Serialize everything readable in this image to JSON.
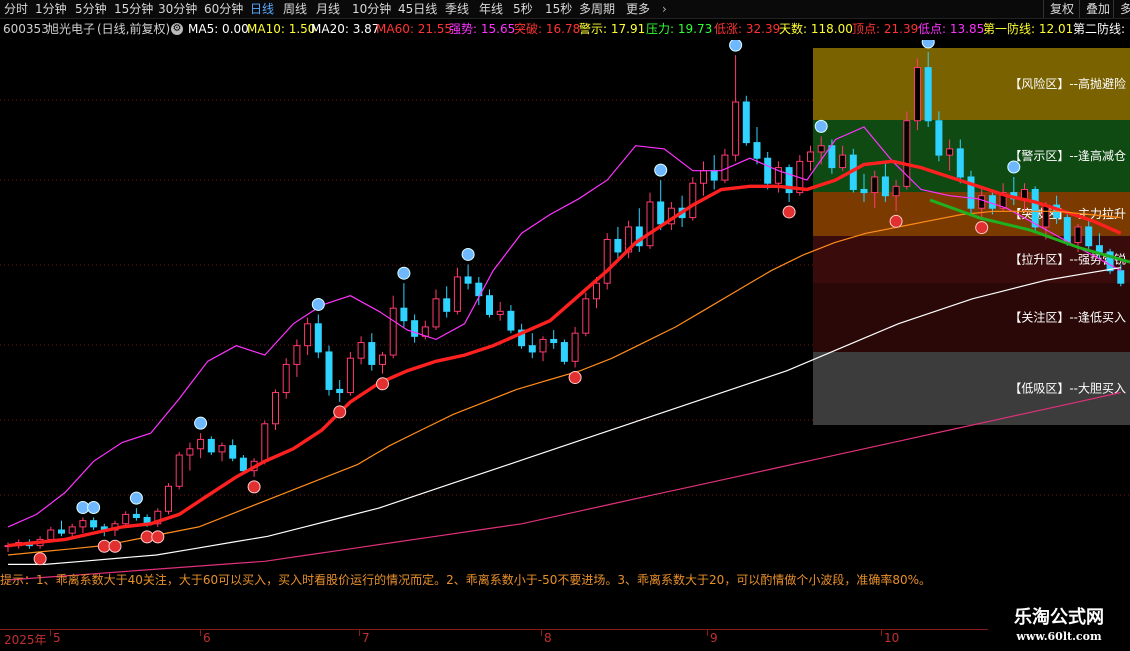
{
  "toolbar": {
    "tabs": [
      "分时",
      "1分钟",
      "5分钟",
      "15分钟",
      "30分钟",
      "60分钟",
      "日线",
      "周线",
      "月线",
      "10分钟",
      "45日线",
      "季线",
      "年线",
      "5秒",
      "15秒",
      "多周期",
      "更多"
    ],
    "active_tab": "日线",
    "more_arrow": "›",
    "right_buttons": [
      "复权",
      "叠加",
      "多"
    ]
  },
  "stock": {
    "code": "600353",
    "name": "旭光电子",
    "period": "(日线,前复权)"
  },
  "indicators": [
    {
      "label": "MA5: 0.00",
      "color": "#ffffff"
    },
    {
      "label": "MA10: 1.50",
      "color": "#ffff33"
    },
    {
      "label": "MA20: 3.87",
      "color": "#ffffff"
    },
    {
      "label": "MA60: 21.55",
      "color": "#ff3333"
    },
    {
      "label": "强势: 15.65",
      "color": "#ff33ff"
    },
    {
      "label": "突破: 16.78",
      "color": "#ff3333"
    },
    {
      "label": "警示: 17.91",
      "color": "#ffff33"
    },
    {
      "label": "压力: 19.73",
      "color": "#33ff33"
    },
    {
      "label": "低涨: 32.39",
      "color": "#ff3333"
    },
    {
      "label": "天数: 118.00",
      "color": "#ffff33"
    },
    {
      "label": "顶点: 21.39",
      "color": "#ff3333"
    },
    {
      "label": "低点: 13.85",
      "color": "#ff33ff"
    },
    {
      "label": "第一防线: 12.01",
      "color": "#ffff33"
    },
    {
      "label": "第二防线:",
      "color": "#ffffff"
    }
  ],
  "zones": [
    {
      "label": "【风险区】--高抛避险",
      "color": "#7a6200"
    },
    {
      "label": "【警示区】--逢高减仓",
      "color": "#0e4a12"
    },
    {
      "label": "【突破区】--主力拉升",
      "color": "#7a3a00"
    },
    {
      "label": "【拉升区】--强势营锐",
      "color": "#3a0b0b"
    },
    {
      "label": "【关注区】--逢低买入",
      "color": "#2a0808"
    },
    {
      "label": "【低吸区】--大胆买入",
      "color": "#3c3c3c"
    }
  ],
  "hint": "提示：1、乖离系数大于40关注，大于60可以买入，买入时看股价运行的情况而定。2、乖离系数小于-50不要进场。3、乖离系数大于20，可以酌情做个小波段，准确率80%。",
  "datebar": {
    "year": "2025年",
    "months": [
      "5",
      "6",
      "7",
      "8",
      "9",
      "10"
    ]
  },
  "watermark": {
    "title": "乐淘公式网",
    "url": "www.60lt.com"
  },
  "chart_data": {
    "type": "candlestick",
    "price_range": [
      4.5,
      21.4
    ],
    "ohlc": [
      [
        5.6,
        5.7,
        5.4,
        5.6
      ],
      [
        5.6,
        5.8,
        5.5,
        5.7
      ],
      [
        5.7,
        5.8,
        5.5,
        5.6
      ],
      [
        5.6,
        5.9,
        5.5,
        5.8
      ],
      [
        5.8,
        6.2,
        5.7,
        6.1
      ],
      [
        6.1,
        6.4,
        5.9,
        6.0
      ],
      [
        6.0,
        6.3,
        5.8,
        6.2
      ],
      [
        6.2,
        6.5,
        6.0,
        6.4
      ],
      [
        6.4,
        6.5,
        6.1,
        6.2
      ],
      [
        6.2,
        6.3,
        5.9,
        6.1
      ],
      [
        6.1,
        6.4,
        5.9,
        6.3
      ],
      [
        6.3,
        6.7,
        6.2,
        6.6
      ],
      [
        6.6,
        6.8,
        6.4,
        6.5
      ],
      [
        6.5,
        6.6,
        6.2,
        6.3
      ],
      [
        6.3,
        6.8,
        6.2,
        6.7
      ],
      [
        6.7,
        7.6,
        6.6,
        7.5
      ],
      [
        7.5,
        8.6,
        7.4,
        8.5
      ],
      [
        8.5,
        8.9,
        8.0,
        8.7
      ],
      [
        8.7,
        9.2,
        8.4,
        9.0
      ],
      [
        9.0,
        9.1,
        8.5,
        8.6
      ],
      [
        8.6,
        8.9,
        8.3,
        8.8
      ],
      [
        8.8,
        9.0,
        8.3,
        8.4
      ],
      [
        8.4,
        8.5,
        7.9,
        8.0
      ],
      [
        8.0,
        8.4,
        7.8,
        8.3
      ],
      [
        8.3,
        9.6,
        8.2,
        9.5
      ],
      [
        9.5,
        10.6,
        9.3,
        10.5
      ],
      [
        10.5,
        11.6,
        10.3,
        11.4
      ],
      [
        11.4,
        12.2,
        11.0,
        12.0
      ],
      [
        12.0,
        12.9,
        11.7,
        12.7
      ],
      [
        12.7,
        13.0,
        11.6,
        11.8
      ],
      [
        11.8,
        12.0,
        10.4,
        10.6
      ],
      [
        10.6,
        10.9,
        10.2,
        10.5
      ],
      [
        10.5,
        11.8,
        10.4,
        11.6
      ],
      [
        11.6,
        12.3,
        11.4,
        12.1
      ],
      [
        12.1,
        12.4,
        11.2,
        11.4
      ],
      [
        11.4,
        11.8,
        11.1,
        11.7
      ],
      [
        11.7,
        13.6,
        11.6,
        13.2
      ],
      [
        13.2,
        14.0,
        12.6,
        12.8
      ],
      [
        12.8,
        13.0,
        12.1,
        12.3
      ],
      [
        12.3,
        12.8,
        12.2,
        12.6
      ],
      [
        12.6,
        13.8,
        12.5,
        13.5
      ],
      [
        13.5,
        13.9,
        12.9,
        13.1
      ],
      [
        13.1,
        14.5,
        13.0,
        14.2
      ],
      [
        14.2,
        14.6,
        13.8,
        14.0
      ],
      [
        14.0,
        14.2,
        13.3,
        13.6
      ],
      [
        13.6,
        13.8,
        12.9,
        13.0
      ],
      [
        13.0,
        13.4,
        12.8,
        13.1
      ],
      [
        13.1,
        13.3,
        12.4,
        12.5
      ],
      [
        12.5,
        12.7,
        11.9,
        12.0
      ],
      [
        12.0,
        12.4,
        11.6,
        11.8
      ],
      [
        11.8,
        12.3,
        11.5,
        12.2
      ],
      [
        12.2,
        12.5,
        11.9,
        12.1
      ],
      [
        12.1,
        12.2,
        11.4,
        11.5
      ],
      [
        11.5,
        12.6,
        11.3,
        12.4
      ],
      [
        12.4,
        13.7,
        12.3,
        13.5
      ],
      [
        13.5,
        14.2,
        13.2,
        14.0
      ],
      [
        14.0,
        15.6,
        13.8,
        15.4
      ],
      [
        15.4,
        15.8,
        14.8,
        15.0
      ],
      [
        15.0,
        16.0,
        14.8,
        15.8
      ],
      [
        15.8,
        16.4,
        15.0,
        15.2
      ],
      [
        15.2,
        16.9,
        15.1,
        16.6
      ],
      [
        16.6,
        17.3,
        15.7,
        15.9
      ],
      [
        15.9,
        16.6,
        15.7,
        16.4
      ],
      [
        16.4,
        16.8,
        15.8,
        16.1
      ],
      [
        16.1,
        17.4,
        16.0,
        17.2
      ],
      [
        17.2,
        17.9,
        16.8,
        17.6
      ],
      [
        17.6,
        18.1,
        17.0,
        17.3
      ],
      [
        17.3,
        18.3,
        17.2,
        18.1
      ],
      [
        18.1,
        21.3,
        17.9,
        19.8
      ],
      [
        19.8,
        20.0,
        18.4,
        18.5
      ],
      [
        18.5,
        19.0,
        17.8,
        18.0
      ],
      [
        18.0,
        18.2,
        17.0,
        17.2
      ],
      [
        17.2,
        17.9,
        16.9,
        17.7
      ],
      [
        17.7,
        17.8,
        16.6,
        16.9
      ],
      [
        16.9,
        18.1,
        16.8,
        17.9
      ],
      [
        17.9,
        18.4,
        17.6,
        18.2
      ],
      [
        18.2,
        18.7,
        17.8,
        18.4
      ],
      [
        18.4,
        18.6,
        17.5,
        17.7
      ],
      [
        17.7,
        18.4,
        17.6,
        18.1
      ],
      [
        18.1,
        18.3,
        16.9,
        17.0
      ],
      [
        17.0,
        17.5,
        16.6,
        16.9
      ],
      [
        16.9,
        17.6,
        16.4,
        17.4
      ],
      [
        17.4,
        17.9,
        16.6,
        16.8
      ],
      [
        16.8,
        17.3,
        16.3,
        17.1
      ],
      [
        17.1,
        19.5,
        17.0,
        19.2
      ],
      [
        19.2,
        21.2,
        18.9,
        20.9
      ],
      [
        20.9,
        21.4,
        19.0,
        19.2
      ],
      [
        19.2,
        19.5,
        17.9,
        18.1
      ],
      [
        18.1,
        18.6,
        17.6,
        18.3
      ],
      [
        18.3,
        18.6,
        17.2,
        17.4
      ],
      [
        17.4,
        17.6,
        16.2,
        16.4
      ],
      [
        16.4,
        17.1,
        16.1,
        16.8
      ],
      [
        16.8,
        16.9,
        16.2,
        16.4
      ],
      [
        16.4,
        17.2,
        16.3,
        16.9
      ],
      [
        16.9,
        17.4,
        16.5,
        16.7
      ],
      [
        16.7,
        17.2,
        16.3,
        17.0
      ],
      [
        17.0,
        17.1,
        15.6,
        15.8
      ],
      [
        15.8,
        16.6,
        15.4,
        16.5
      ],
      [
        16.5,
        16.8,
        15.9,
        16.1
      ],
      [
        16.1,
        16.2,
        15.2,
        15.3
      ],
      [
        15.3,
        15.9,
        15.0,
        15.8
      ],
      [
        15.8,
        16.0,
        15.1,
        15.2
      ],
      [
        15.2,
        15.6,
        14.8,
        15.0
      ],
      [
        15.0,
        15.1,
        14.3,
        14.4
      ],
      [
        14.4,
        14.6,
        13.9,
        14.0
      ]
    ],
    "ma_series": [
      {
        "values": [
          6.2,
          6.6,
          7.3,
          8.3,
          8.9,
          9.2,
          10.3,
          11.5,
          12.0,
          11.7,
          12.7,
          13.3,
          13.6,
          13.1,
          12.5,
          12.2,
          12.7,
          14.4,
          15.6,
          16.2,
          16.7,
          17.3,
          18.4,
          18.3,
          17.6,
          17.6,
          18.0,
          17.6,
          17.3,
          18.6,
          19.0,
          17.9,
          17.0,
          16.8,
          16.7,
          16.4,
          15.9,
          15.4,
          14.9,
          14.4
        ],
        "color": "#ff33ff"
      },
      {
        "values": [
          5.6,
          5.7,
          5.8,
          6.0,
          6.2,
          6.3,
          6.6,
          7.2,
          7.8,
          8.3,
          8.7,
          9.3,
          10.2,
          10.8,
          11.2,
          11.5,
          11.7,
          12.0,
          12.4,
          12.8,
          13.6,
          14.4,
          15.3,
          15.9,
          16.5,
          17.0,
          17.1,
          17.1,
          17.0,
          17.3,
          17.8,
          17.9,
          17.7,
          17.4,
          17.1,
          16.8,
          16.6,
          16.3,
          16.0,
          15.6
        ],
        "color": "#ff2020",
        "width": 3.4
      },
      {
        "values": [
          5.3,
          5.4,
          5.5,
          5.6,
          5.8,
          6.0,
          6.2,
          6.6,
          7.0,
          7.4,
          7.8,
          8.2,
          8.8,
          9.3,
          9.8,
          10.2,
          10.6,
          10.9,
          11.2,
          11.6,
          12.1,
          12.6,
          13.2,
          13.8,
          14.4,
          14.9,
          15.3,
          15.6,
          15.8,
          16.0,
          16.2,
          16.3,
          16.3,
          16.3,
          16.2,
          16.1
        ],
        "color": "#ff8c1a"
      },
      {
        "values": [
          5.0,
          5.0,
          5.1,
          5.2,
          5.3,
          5.5,
          5.7,
          5.9,
          6.2,
          6.5,
          6.8,
          7.2,
          7.6,
          8.0,
          8.4,
          8.8,
          9.2,
          9.6,
          10.0,
          10.4,
          10.8,
          11.2,
          11.7,
          12.2,
          12.7,
          13.1,
          13.5,
          13.8,
          14.1,
          14.3,
          14.5
        ],
        "color": "#ffffff"
      },
      {
        "values": [
          4.5,
          4.6,
          4.7,
          4.8,
          4.9,
          5.0,
          5.1,
          5.3,
          5.5,
          5.7,
          5.9,
          6.1,
          6.3,
          6.6,
          6.9,
          7.2,
          7.5,
          7.8,
          8.1,
          8.4,
          8.7,
          9.0,
          9.3,
          9.6,
          9.9,
          10.2,
          10.5
        ],
        "color": "#e0307a"
      }
    ]
  }
}
